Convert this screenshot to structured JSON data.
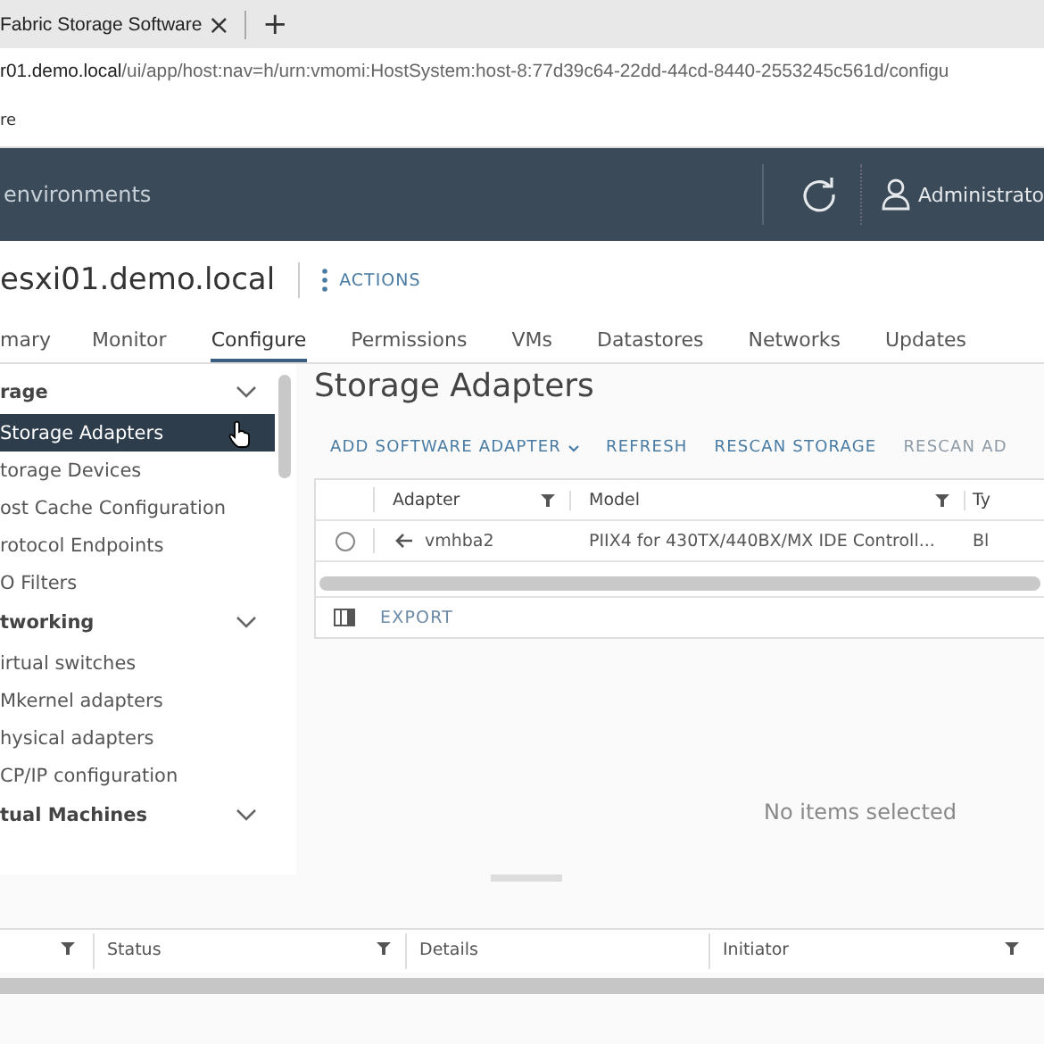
{
  "browser": {
    "tab": {
      "title": "Fabric Storage Software",
      "close": "×"
    },
    "new_tab": "+",
    "address": {
      "host": "r01.demo.local",
      "path": "/ui/app/host:nav=h/urn:vmomi:HostSystem:host-8:77d39c64-22dd-44cd-8440-2553245c561d/configu"
    },
    "bookmark": "re"
  },
  "header": {
    "title": "environments",
    "user": "Administrato"
  },
  "object": {
    "title": "esxi01.demo.local",
    "actions": "ACTIONS"
  },
  "tabs": [
    {
      "label": "mary",
      "selected": false
    },
    {
      "label": "Monitor",
      "selected": false
    },
    {
      "label": "Configure",
      "selected": true
    },
    {
      "label": "Permissions",
      "selected": false
    },
    {
      "label": "VMs",
      "selected": false
    },
    {
      "label": "Datastores",
      "selected": false
    },
    {
      "label": "Networks",
      "selected": false
    },
    {
      "label": "Updates",
      "selected": false
    }
  ],
  "sidebar": {
    "groups": [
      {
        "label": "rage",
        "expanded": true,
        "items": [
          {
            "label": "Storage Adapters",
            "selected": true
          },
          {
            "label": "torage Devices",
            "selected": false
          },
          {
            "label": "ost Cache Configuration",
            "selected": false
          },
          {
            "label": "rotocol Endpoints",
            "selected": false
          },
          {
            "label": "O Filters",
            "selected": false
          }
        ]
      },
      {
        "label": "tworking",
        "expanded": true,
        "items": [
          {
            "label": "irtual switches",
            "selected": false
          },
          {
            "label": "Mkernel adapters",
            "selected": false
          },
          {
            "label": "hysical adapters",
            "selected": false
          },
          {
            "label": "CP/IP configuration",
            "selected": false
          }
        ]
      },
      {
        "label": "tual Machines",
        "expanded": true
      }
    ]
  },
  "content": {
    "title": "Storage Adapters",
    "toolbar": [
      {
        "label": "ADD SOFTWARE ADAPTER",
        "kind": "dropdown",
        "disabled": false
      },
      {
        "label": "REFRESH",
        "kind": "button",
        "disabled": false
      },
      {
        "label": "RESCAN STORAGE",
        "kind": "button",
        "disabled": false
      },
      {
        "label": "RESCAN AD",
        "kind": "button",
        "disabled": true
      }
    ],
    "table": {
      "columns": [
        "Adapter",
        "Model",
        "Ty"
      ],
      "rows": [
        {
          "selected": false,
          "cells": [
            "vmhba2",
            "PIIX4 for 430TX/440BX/MX IDE Controll...",
            "Bl"
          ]
        }
      ],
      "export": "EXPORT"
    },
    "empty_message": "No items selected"
  },
  "bottom_table": {
    "columns": [
      "Status",
      "Details",
      "Initiator"
    ]
  }
}
